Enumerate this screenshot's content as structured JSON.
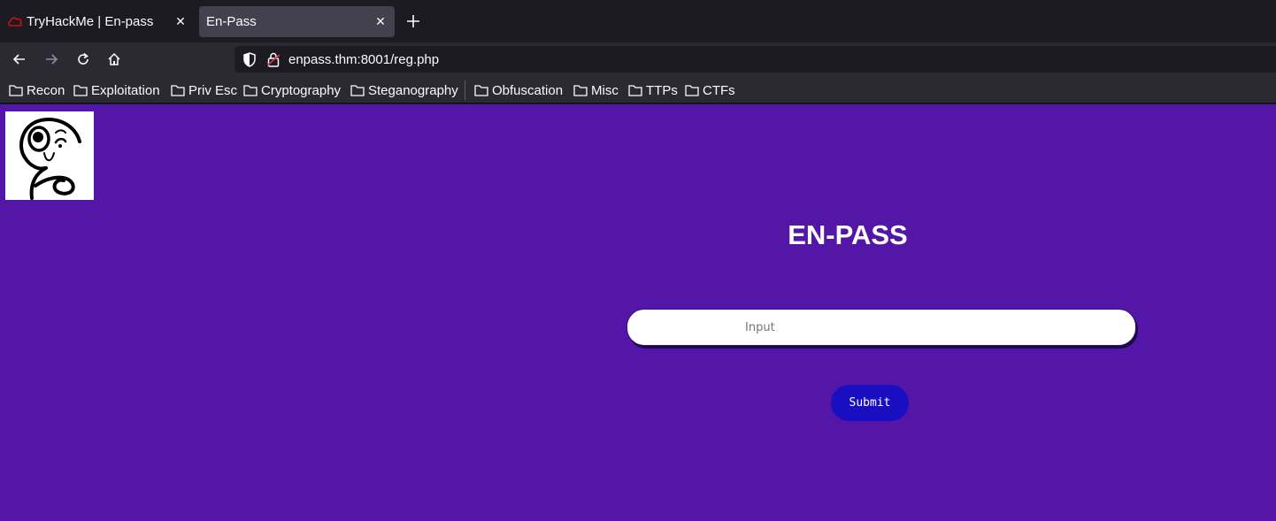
{
  "browser": {
    "tabs": [
      {
        "title": "TryHackMe | En-pass",
        "active": false,
        "favicon": "tryhackme-cloud-icon"
      },
      {
        "title": "En-Pass",
        "active": true
      }
    ],
    "url": "enpass.thm:8001/reg.php",
    "bookmarks": [
      "Recon",
      "Exploitation",
      "Priv Esc",
      "Cryptography",
      "Steganography",
      "Obfuscation",
      "Misc",
      "TTPs",
      "CTFs"
    ]
  },
  "page": {
    "heading": "EN-PASS",
    "input_placeholder": "Input",
    "submit_label": "Submit",
    "background_color": "#5316a6",
    "button_color": "#1a0fc0"
  }
}
